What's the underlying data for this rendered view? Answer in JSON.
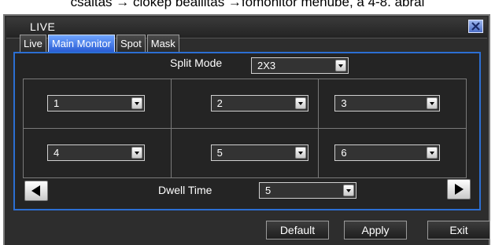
{
  "caption": "csaltas → ciokep beallitas →fomonitor menube, a 4-8. abrai",
  "window": {
    "title": "LIVE",
    "close_glyph": "✕"
  },
  "tabs": [
    {
      "label": "Live",
      "active": false
    },
    {
      "label": "Main Monitor",
      "active": true
    },
    {
      "label": "Spot",
      "active": false
    },
    {
      "label": "Mask",
      "active": false
    }
  ],
  "split_mode": {
    "label": "Split Mode",
    "value": "2X3"
  },
  "channels": [
    "1",
    "2",
    "3",
    "4",
    "5",
    "6"
  ],
  "dwell": {
    "label": "Dwell Time",
    "value": "5"
  },
  "buttons": {
    "default": "Default",
    "apply": "Apply",
    "exit": "Exit"
  },
  "colors": {
    "accent": "#2c6fd3",
    "active_tab": "#3b74e0"
  }
}
